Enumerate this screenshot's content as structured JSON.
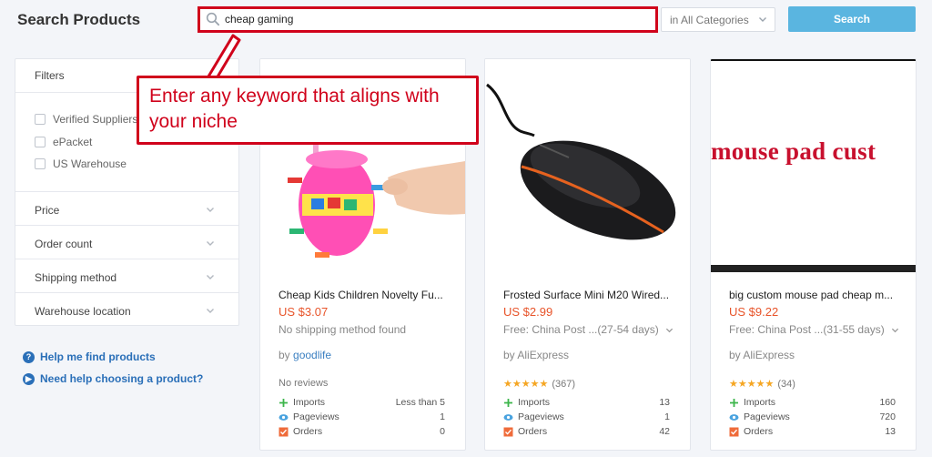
{
  "header": {
    "title": "Search Products",
    "search_value": "cheap gaming",
    "category": "in All Categories",
    "search_button": "Search"
  },
  "sidebar": {
    "filters_title": "Filters",
    "checkboxes": [
      "Verified Suppliers",
      "ePacket",
      "US Warehouse"
    ],
    "accordions": [
      "Price",
      "Order count",
      "Shipping method",
      "Warehouse location"
    ],
    "help_links": [
      "Help me find products",
      "Need help choosing a product?"
    ]
  },
  "callout": {
    "text": "Enter any keyword that aligns with your niche"
  },
  "products": [
    {
      "title": "Cheap Kids Children Novelty Fu...",
      "price": "US $3.07",
      "shipping": "No shipping method found",
      "by_prefix": "by",
      "seller": "goodlife",
      "rating_text": "No reviews",
      "stats": {
        "imports": "Less than 5",
        "pageviews": "1",
        "orders": "0"
      }
    },
    {
      "title": "Frosted Surface Mini M20 Wired...",
      "price": "US $2.99",
      "shipping": "Free: China Post ...(27-54 days)",
      "by_prefix": "by",
      "seller": "AliExpress",
      "rating_text": "(367)",
      "stars": "★★★★★",
      "stats": {
        "imports": "13",
        "pageviews": "1",
        "orders": "42"
      }
    },
    {
      "title": "big custom mouse pad cheap m...",
      "price": "US $9.22",
      "shipping": "Free: China Post ...(31-55 days)",
      "by_prefix": "by",
      "seller": "AliExpress",
      "rating_text": "(34)",
      "stars": "★★★★★",
      "image_text": "mouse pad cust",
      "stats": {
        "imports": "160",
        "pageviews": "720",
        "orders": "13"
      }
    }
  ],
  "stat_labels": {
    "imports": "Imports",
    "pageviews": "Pageviews",
    "orders": "Orders"
  },
  "colors": {
    "accent": "#5ab5e0",
    "price": "#e8542a",
    "link": "#2a6fb8",
    "highlight": "#d0021b",
    "star": "#f5a623"
  }
}
